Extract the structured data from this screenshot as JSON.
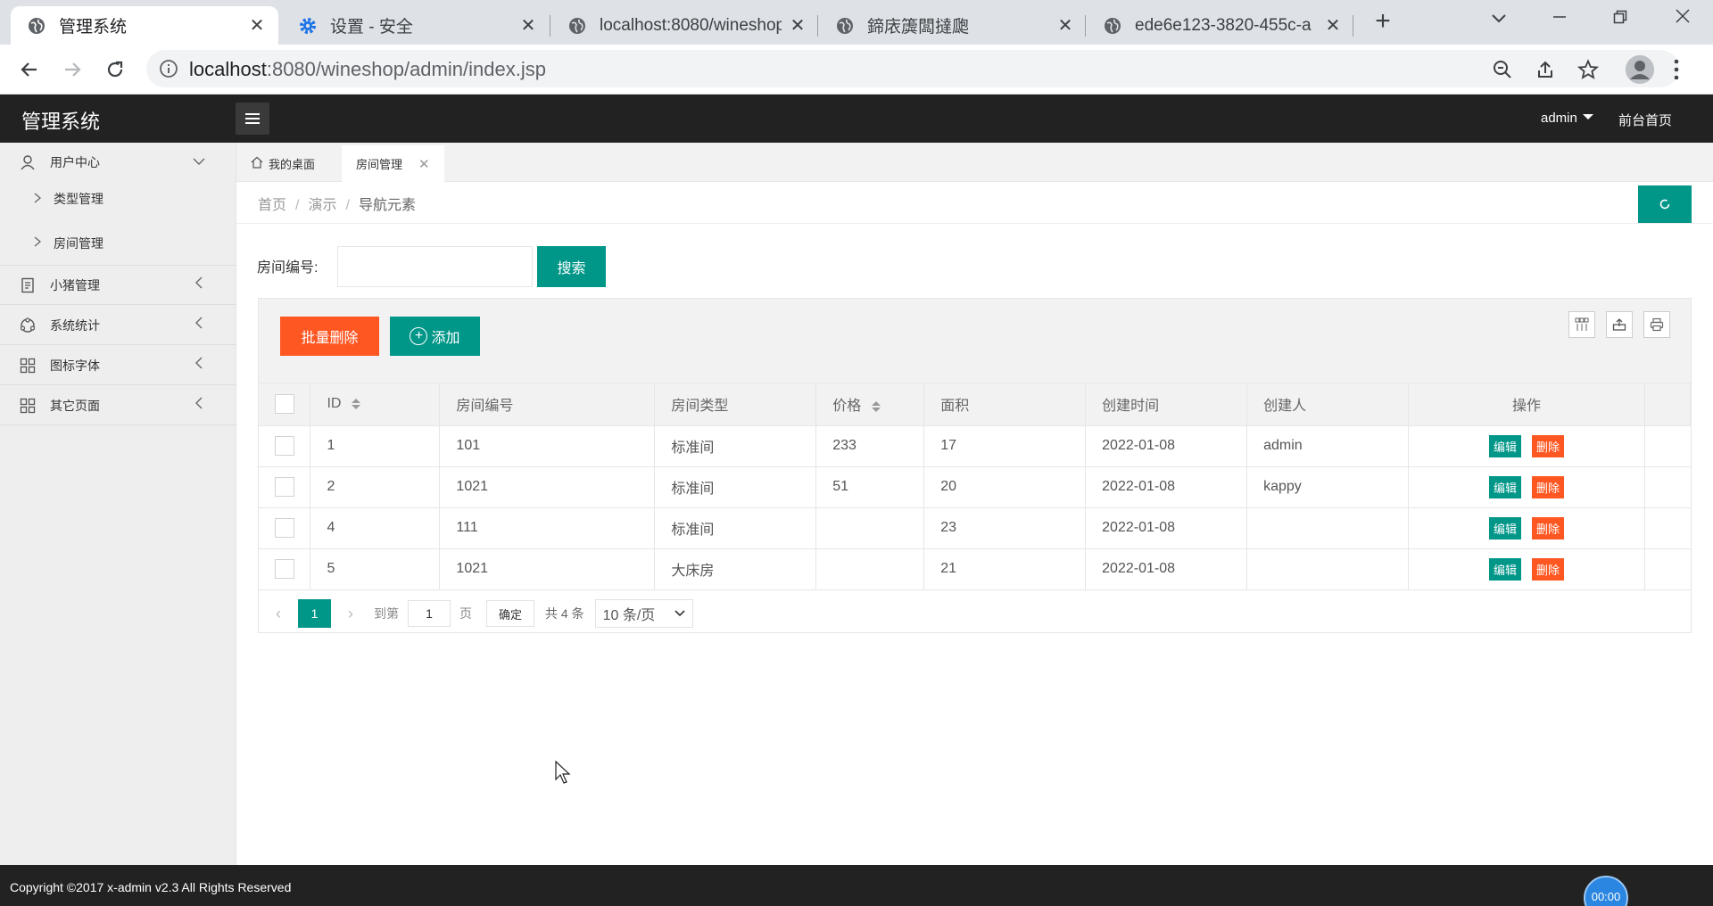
{
  "browser": {
    "tabs": [
      {
        "title": "管理系统",
        "icon": "globe-icon"
      },
      {
        "title": "设置 - 安全",
        "icon": "gear-icon"
      },
      {
        "title": "localhost:8080/wineshop",
        "icon": "globe-icon"
      },
      {
        "title": "鍗庡簴闆撻瓟",
        "icon": "globe-icon"
      },
      {
        "title": "ede6e123-3820-455c-a",
        "icon": "globe-icon"
      }
    ],
    "url_host": "localhost",
    "url_rest": ":8080/wineshop/admin/index.jsp"
  },
  "app": {
    "logo": "管理系统",
    "user": "admin",
    "front_link": "前台首页"
  },
  "sidebar": {
    "items": [
      {
        "label": "用户中心",
        "icon": "user-icon",
        "arrow": "down"
      },
      {
        "label": "小猪管理",
        "icon": "document-icon",
        "arrow": "left"
      },
      {
        "label": "系统统计",
        "icon": "chart-icon",
        "arrow": "left"
      },
      {
        "label": "图标字体",
        "icon": "grid-icon",
        "arrow": "left"
      },
      {
        "label": "其它页面",
        "icon": "grid-icon",
        "arrow": "left"
      }
    ],
    "subitems": [
      {
        "label": "类型管理"
      },
      {
        "label": "房间管理"
      }
    ]
  },
  "tabs": [
    {
      "label": "我的桌面"
    },
    {
      "label": "房间管理"
    }
  ],
  "breadcrumb": [
    "首页",
    "演示",
    "导航元素"
  ],
  "search": {
    "label": "房间编号:",
    "value": "",
    "button": "搜索"
  },
  "toolbar": {
    "batch_delete": "批量删除",
    "add": "添加"
  },
  "table": {
    "columns": [
      "ID",
      "房间编号",
      "房间类型",
      "价格",
      "面积",
      "创建时间",
      "创建人",
      "操作"
    ],
    "rows": [
      {
        "id": "1",
        "room_no": "101",
        "type": "标准间",
        "price": "233",
        "area": "17",
        "created": "2022-01-08",
        "creator": "admin"
      },
      {
        "id": "2",
        "room_no": "1021",
        "type": "标准间",
        "price": "51",
        "area": "20",
        "created": "2022-01-08",
        "creator": "kappy"
      },
      {
        "id": "4",
        "room_no": "111",
        "type": "标准间",
        "price": "",
        "area": "23",
        "created": "2022-01-08",
        "creator": ""
      },
      {
        "id": "5",
        "room_no": "1021",
        "type": "大床房",
        "price": "",
        "area": "21",
        "created": "2022-01-08",
        "creator": ""
      }
    ],
    "edit_label": "编辑",
    "delete_label": "删除"
  },
  "pager": {
    "current": "1",
    "goto_prefix": "到第",
    "goto_value": "1",
    "goto_suffix": "页",
    "confirm": "确定",
    "total": "共 4 条",
    "page_size": "10 条/页"
  },
  "footer": {
    "copyright": "Copyright ©2017 x-admin v2.3 All Rights Reserved"
  },
  "timer": "00:00",
  "colors": {
    "primary": "#009688",
    "danger": "#ff5722",
    "header": "#222222"
  }
}
